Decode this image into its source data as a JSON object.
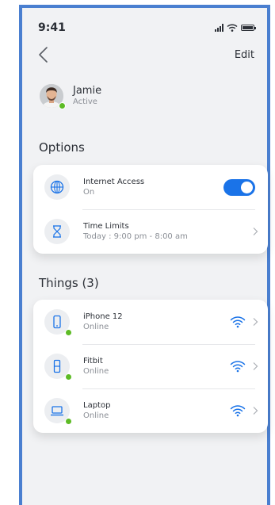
{
  "status_bar": {
    "time": "9:41"
  },
  "nav": {
    "edit_label": "Edit"
  },
  "profile": {
    "name": "Jamie",
    "status": "Active",
    "status_color": "#5dbb25"
  },
  "options": {
    "title": "Options",
    "internet": {
      "label": "Internet Access",
      "value": "On",
      "enabled": true,
      "icon": "globe-icon"
    },
    "time_limits": {
      "label": "Time Limits",
      "value": "Today : 9:00 pm - 8:00 am",
      "icon": "hourglass-icon"
    }
  },
  "things": {
    "title": "Things (3)",
    "items": [
      {
        "name": "iPhone 12",
        "status": "Online",
        "icon": "phone-icon"
      },
      {
        "name": "Fitbit",
        "status": "Online",
        "icon": "watch-icon"
      },
      {
        "name": "Laptop",
        "status": "Online",
        "icon": "laptop-icon"
      }
    ]
  },
  "colors": {
    "accent": "#1a73e8",
    "online": "#5dbb25",
    "frame_border": "#4a7fd0"
  }
}
